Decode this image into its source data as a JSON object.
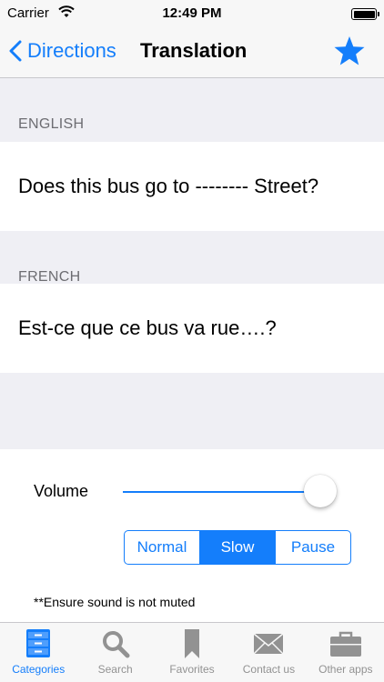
{
  "status_bar": {
    "carrier": "Carrier",
    "time": "12:49 PM"
  },
  "nav": {
    "back_label": "Directions",
    "title": "Translation",
    "accent_color": "#147efb"
  },
  "sections": {
    "english_header": "ENGLISH",
    "english_text": "Does this bus go to -------- Street?",
    "french_header": "FRENCH",
    "french_text": "Est-ce que ce bus va  rue….?"
  },
  "audio": {
    "volume_label": "Volume",
    "volume_level": 0.9,
    "speed_options": [
      "Normal",
      "Slow",
      "Pause"
    ],
    "selected_option": "Slow",
    "note": "**Ensure sound is not muted"
  },
  "tabbar": {
    "tabs": [
      {
        "label": "Categories",
        "icon": "cabinet-icon",
        "active": true
      },
      {
        "label": "Search",
        "icon": "magnifier-icon",
        "active": false
      },
      {
        "label": "Favorites",
        "icon": "bookmark-icon",
        "active": false
      },
      {
        "label": "Contact us",
        "icon": "envelope-icon",
        "active": false
      },
      {
        "label": "Other apps",
        "icon": "briefcase-icon",
        "active": false
      }
    ]
  }
}
